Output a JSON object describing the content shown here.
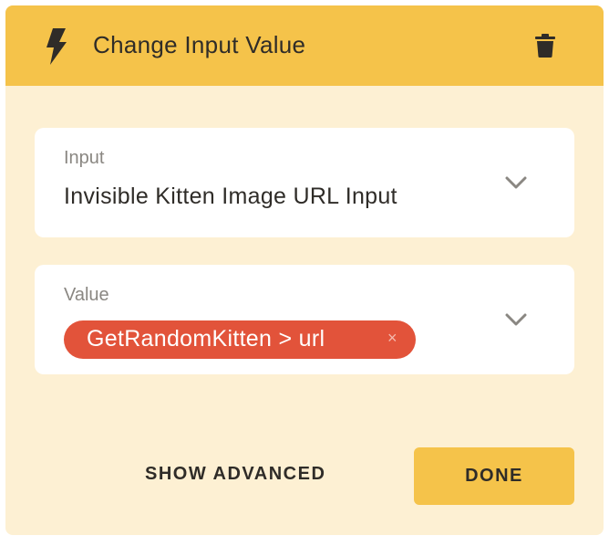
{
  "header": {
    "title": "Change Input Value",
    "icon": "lightning-bolt-icon",
    "delete_icon": "trash-icon",
    "background": "#f5c34a"
  },
  "fields": {
    "input": {
      "label": "Input",
      "value": "Invisible Kitten Image URL Input"
    },
    "value": {
      "label": "Value",
      "token": "GetRandomKitten > url",
      "token_close": "×",
      "token_color": "#e2533a"
    }
  },
  "footer": {
    "show_advanced_label": "SHOW ADVANCED",
    "done_label": "DONE"
  },
  "colors": {
    "panel": "#fdf0d3",
    "accent": "#f5c34a"
  }
}
